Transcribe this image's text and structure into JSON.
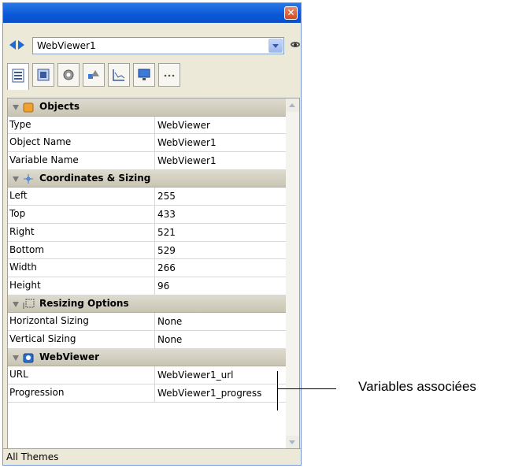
{
  "window": {
    "close_label": "✕"
  },
  "selector": {
    "object_name": "WebViewer1"
  },
  "tabs": [
    {
      "icon": "list-properties-icon",
      "active": true
    },
    {
      "icon": "display-icon",
      "active": false
    },
    {
      "icon": "gear-icon",
      "active": false
    },
    {
      "icon": "shapes-icon",
      "active": false
    },
    {
      "icon": "chart-icon",
      "active": false
    },
    {
      "icon": "monitor-icon",
      "active": false
    },
    {
      "icon": "more-icon",
      "active": false
    }
  ],
  "sections": [
    {
      "title": "Objects",
      "icon": "objects-icon",
      "rows": [
        {
          "name": "Type",
          "value": "WebViewer"
        },
        {
          "name": "Object Name",
          "value": "WebViewer1"
        },
        {
          "name": "Variable Name",
          "value": "WebViewer1"
        }
      ]
    },
    {
      "title": "Coordinates & Sizing",
      "icon": "coordinates-icon",
      "rows": [
        {
          "name": "Left",
          "value": "255"
        },
        {
          "name": "Top",
          "value": "433"
        },
        {
          "name": "Right",
          "value": "521"
        },
        {
          "name": "Bottom",
          "value": "529"
        },
        {
          "name": "Width",
          "value": "266"
        },
        {
          "name": "Height",
          "value": "96"
        }
      ]
    },
    {
      "title": "Resizing Options",
      "icon": "resizing-icon",
      "rows": [
        {
          "name": "Horizontal Sizing",
          "value": "None"
        },
        {
          "name": "Vertical Sizing",
          "value": "None"
        }
      ]
    },
    {
      "title": "WebViewer",
      "icon": "webviewer-icon",
      "rows": [
        {
          "name": "URL",
          "value": "WebViewer1_url"
        },
        {
          "name": "Progression",
          "value": "WebViewer1_progress"
        }
      ]
    }
  ],
  "status": {
    "theme": "All Themes"
  },
  "annotation": {
    "label": "Variables associées"
  },
  "colors": {
    "titlebar": "#0b58d8",
    "section_header": "#d4d0c8",
    "close": "#d24b1d"
  }
}
